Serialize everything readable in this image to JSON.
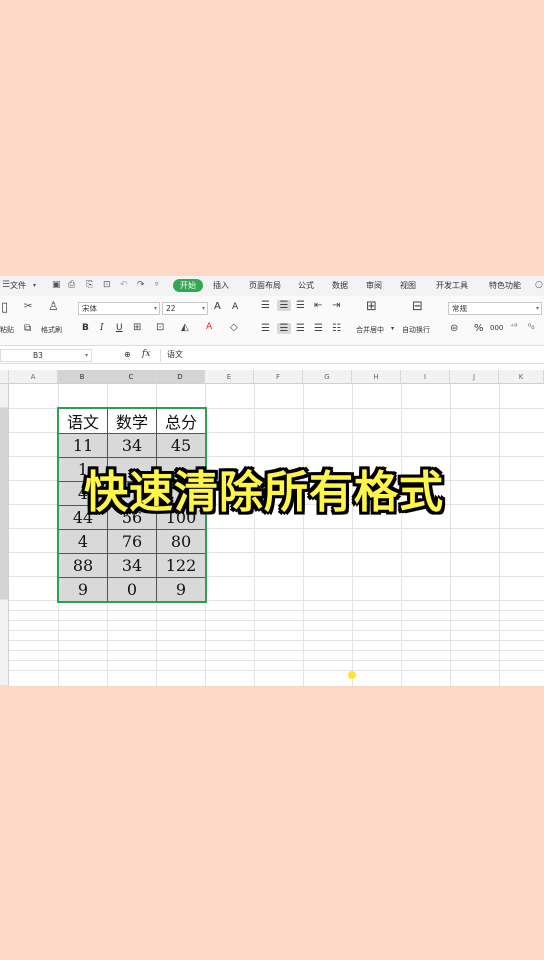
{
  "menubar": {
    "items": [
      {
        "label": "文件"
      },
      {
        "label": "开始"
      },
      {
        "label": "插入"
      },
      {
        "label": "页面布局"
      },
      {
        "label": "公式"
      },
      {
        "label": "数据"
      },
      {
        "label": "审阅"
      },
      {
        "label": "视图"
      },
      {
        "label": "开发工具"
      },
      {
        "label": "特色功能"
      }
    ],
    "active_tab": "开始",
    "active_color": "#32a852"
  },
  "ribbon": {
    "paste_label": "粘贴",
    "format_painter_label": "格式刷",
    "font_name": "宋体",
    "font_size": "22",
    "grow_font": "A",
    "shrink_font": "A",
    "bold": "B",
    "italic": "I",
    "underline": "U",
    "font_color_glyph": "A",
    "merge_center_label": "合并居中",
    "wrap_text_label": "自动换行",
    "number_format": "常规",
    "percent": "%",
    "thousands": "000"
  },
  "formula_bar": {
    "cell_ref": "B3",
    "fx_label": "fx",
    "content": "语文"
  },
  "columns": [
    "A",
    "B",
    "C",
    "D",
    "E",
    "F",
    "G",
    "H",
    "I",
    "J",
    "K"
  ],
  "table": {
    "header": [
      "语文",
      "数学",
      "总分"
    ],
    "rows": [
      [
        "11",
        "34",
        "45"
      ],
      [
        "1",
        "",
        ""
      ],
      [
        "4",
        "",
        ""
      ],
      [
        "44",
        "56",
        "100"
      ],
      [
        "4",
        "76",
        "80"
      ],
      [
        "88",
        "34",
        "122"
      ],
      [
        "9",
        "0",
        "9"
      ]
    ]
  },
  "overlay_title": "快速清除所有格式",
  "colors": {
    "page_bg": "#fcd9c6",
    "selection_border": "#2ea04f",
    "title_fill": "#fff64a"
  }
}
